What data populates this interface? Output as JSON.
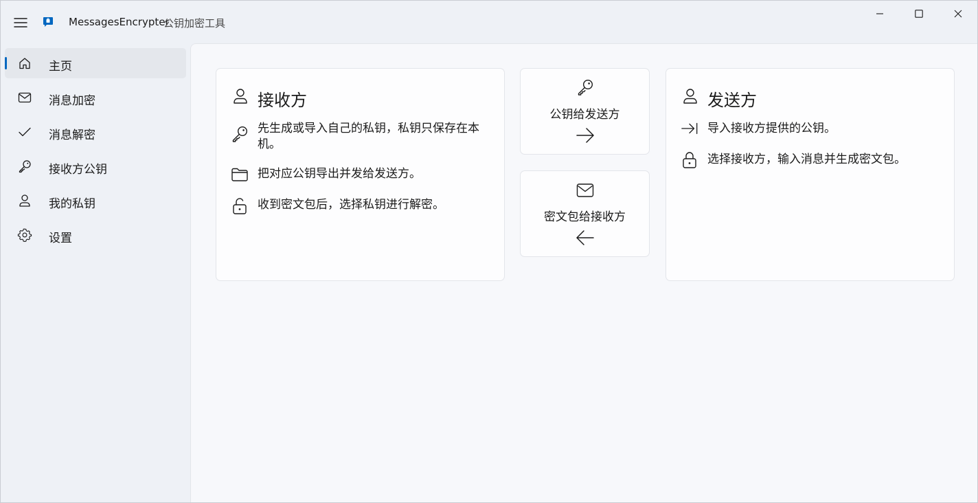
{
  "window": {
    "title": "MessagesEncrypter",
    "subtitle": "公钥加密工具"
  },
  "sidebar": {
    "items": [
      {
        "label": "主页",
        "icon": "home-icon",
        "selected": true
      },
      {
        "label": "消息加密",
        "icon": "mail-icon"
      },
      {
        "label": "消息解密",
        "icon": "checkmark-icon"
      },
      {
        "label": "接收方公钥",
        "icon": "key-icon"
      },
      {
        "label": "我的私钥",
        "icon": "person-icon"
      },
      {
        "label": "设置",
        "icon": "gear-icon"
      }
    ]
  },
  "receiver_card": {
    "title": "接收方",
    "steps": [
      {
        "icon": "key-icon",
        "text": "先生成或导入自己的私钥，私钥只保存在本机。"
      },
      {
        "icon": "folder-icon",
        "text": "把对应公钥导出并发给发送方。"
      },
      {
        "icon": "unlock-icon",
        "text": "收到密文包后，选择私钥进行解密。"
      }
    ]
  },
  "flow_public_key": {
    "label": "公钥给发送方",
    "icon": "key-icon",
    "arrow": "arrow-right-icon"
  },
  "flow_cipher_package": {
    "label": "密文包给接收方",
    "icon": "mail-icon",
    "arrow": "arrow-left-icon"
  },
  "sender_card": {
    "title": "发送方",
    "steps": [
      {
        "icon": "import-arrow-icon",
        "text": "导入接收方提供的公钥。"
      },
      {
        "icon": "lock-icon",
        "text": "选择接收方，输入消息并生成密文包。"
      }
    ]
  },
  "colors": {
    "accent": "#0067c0",
    "app_background": "#eef1f6",
    "content_background": "#f7f8fb",
    "card_background": "#fdfdfe"
  }
}
